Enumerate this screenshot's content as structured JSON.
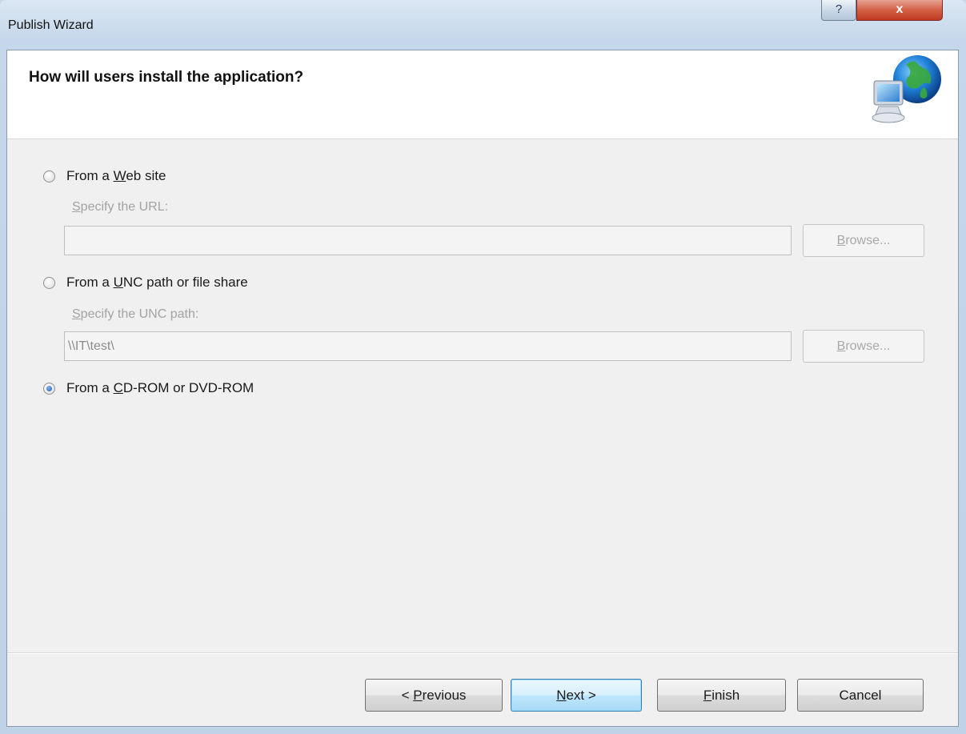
{
  "window": {
    "title": "Publish Wizard",
    "help_glyph": "?",
    "close_glyph": "x"
  },
  "header": {
    "title": "How will users install the application?",
    "icon": "globe-computer-icon"
  },
  "options": {
    "web": {
      "label_prefix": "From a ",
      "label_mnemonic": "W",
      "label_suffix": "eb site",
      "selected": false,
      "field_label_mnemonic": "S",
      "field_label_suffix": "pecify the URL:",
      "value": "",
      "browse_mnemonic": "B",
      "browse_suffix": "rowse..."
    },
    "unc": {
      "label_prefix": "From a ",
      "label_mnemonic": "U",
      "label_suffix": "NC path or file share",
      "selected": false,
      "field_label_mnemonic": "S",
      "field_label_suffix": "pecify the UNC path:",
      "value": "\\\\IT\\test\\",
      "browse_mnemonic": "B",
      "browse_suffix": "rowse..."
    },
    "cd": {
      "label_prefix": "From a ",
      "label_mnemonic": "C",
      "label_suffix": "D-ROM or DVD-ROM",
      "selected": true
    }
  },
  "buttons": {
    "previous_prefix": "< ",
    "previous_mnemonic": "P",
    "previous_suffix": "revious",
    "next_mnemonic": "N",
    "next_suffix": "ext >",
    "finish_mnemonic": "F",
    "finish_suffix": "inish",
    "cancel": "Cancel"
  },
  "colors": {
    "titlebar": "#c5d7ea",
    "close_button": "#c0391f",
    "dialog_bg": "#f0f0f0",
    "header_bg": "#ffffff"
  }
}
